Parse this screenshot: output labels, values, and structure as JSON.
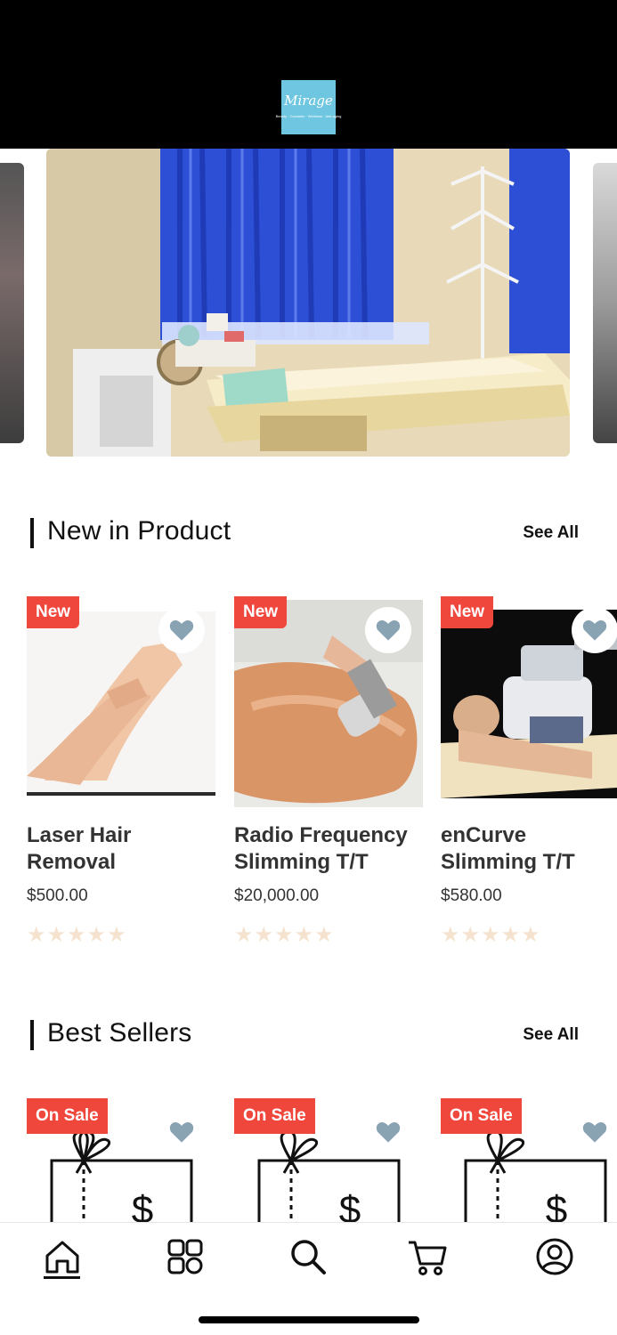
{
  "header": {
    "logo_text": "Mirage",
    "logo_tagline": "Beauty · Cosmetic · Wellness · Anti-aging",
    "background": "#000000",
    "logo_color": "#6ec6e0"
  },
  "hero": {
    "slides_visible": 3,
    "active_slide": 2
  },
  "new_products": {
    "title": "New in Product",
    "see_all": "See All",
    "items": [
      {
        "badge": "New",
        "name": "Laser Hair Removal",
        "price": "$500.00",
        "rating": 0,
        "stars": "★★★★★",
        "favorite_icon": "heart-icon"
      },
      {
        "badge": "New",
        "name": "Radio Frequency Slimming T/T",
        "price": "$20,000.00",
        "rating": 0,
        "stars": "★★★★★",
        "favorite_icon": "heart-icon"
      },
      {
        "badge": "New",
        "name": "enCurve Slimming T/T",
        "price": "$580.00",
        "rating": 0,
        "stars": "★★★★★",
        "favorite_icon": "heart-icon"
      }
    ]
  },
  "best_sellers": {
    "title": "Best Sellers",
    "see_all": "See All",
    "items": [
      {
        "badge": "On Sale",
        "gift_symbol": "$"
      },
      {
        "badge": "On Sale",
        "gift_symbol": "$"
      },
      {
        "badge": "On Sale",
        "gift_symbol": "$"
      }
    ]
  },
  "bottom_nav": {
    "items": [
      {
        "icon": "home-icon",
        "active": true
      },
      {
        "icon": "categories-icon",
        "active": false
      },
      {
        "icon": "search-icon",
        "active": false
      },
      {
        "icon": "cart-icon",
        "active": false
      },
      {
        "icon": "profile-icon",
        "active": false
      }
    ]
  },
  "colors": {
    "badge": "#f0473c",
    "heart": "#8aa3b3",
    "star_empty": "#f6e3cf",
    "text": "#333333"
  }
}
